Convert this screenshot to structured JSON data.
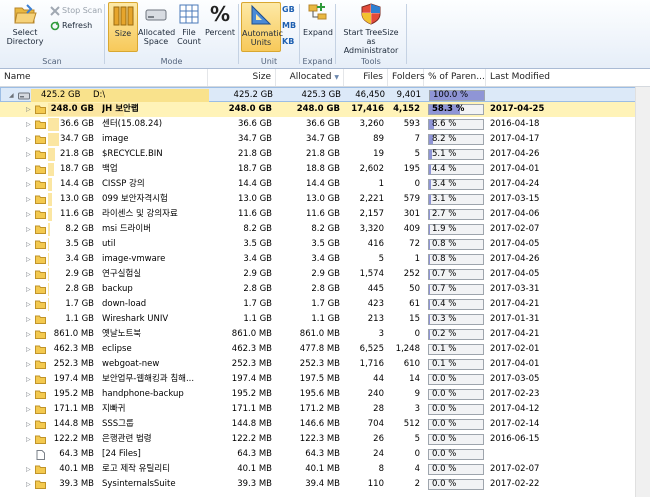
{
  "ribbon": {
    "select_directory": "Select\nDirectory",
    "stop_scan": "Stop Scan",
    "refresh": "Refresh",
    "scan_group": "Scan",
    "size": "Size",
    "allocated_space": "Allocated\nSpace",
    "file_count": "File\nCount",
    "percent": "Percent",
    "mode_group": "Mode",
    "automatic_units": "Automatic\nUnits",
    "unit_gb": "GB",
    "unit_mb": "MB",
    "unit_kb": "KB",
    "unit_group": "Unit",
    "expand": "Expand",
    "expand_group": "Expand",
    "start_admin": "Start TreeSize as\nAdministrator",
    "tools_group": "Tools",
    "percent_glyph": "%"
  },
  "columns": {
    "name": "Name",
    "size": "Size",
    "allocated": "Allocated",
    "files": "Files",
    "folders": "Folders",
    "pct": "% of Paren...",
    "last_modified": "Last Modified"
  },
  "root": {
    "bar_size": "425.2 GB",
    "name": "D:\\",
    "size": "425.2 GB",
    "allocated": "425.3 GB",
    "files": "46,450",
    "folders": "9,401",
    "pct_text": "100.0 %",
    "pct": 100,
    "modified": ""
  },
  "rows": [
    {
      "bar_size": "248.0 GB",
      "name": "JH 보안랩",
      "size": "248.0 GB",
      "allocated": "248.0 GB",
      "files": "17,416",
      "folders": "4,152",
      "pct_text": "58.3 %",
      "pct": 58.3,
      "modified": "2017-04-25",
      "selected": true,
      "kind": "folder"
    },
    {
      "bar_size": "36.6 GB",
      "name": "센터(15.08.24)",
      "size": "36.6 GB",
      "allocated": "36.6 GB",
      "files": "3,260",
      "folders": "593",
      "pct_text": "8.6 %",
      "pct": 8.6,
      "modified": "2016-04-18",
      "kind": "folder"
    },
    {
      "bar_size": "34.7 GB",
      "name": "image",
      "size": "34.7 GB",
      "allocated": "34.7 GB",
      "files": "89",
      "folders": "7",
      "pct_text": "8.2 %",
      "pct": 8.2,
      "modified": "2017-04-17",
      "kind": "folder"
    },
    {
      "bar_size": "21.8 GB",
      "name": "$RECYCLE.BIN",
      "size": "21.8 GB",
      "allocated": "21.8 GB",
      "files": "19",
      "folders": "5",
      "pct_text": "5.1 %",
      "pct": 5.1,
      "modified": "2017-04-26",
      "kind": "folder"
    },
    {
      "bar_size": "18.7 GB",
      "name": "백업",
      "size": "18.7 GB",
      "allocated": "18.8 GB",
      "files": "2,602",
      "folders": "195",
      "pct_text": "4.4 %",
      "pct": 4.4,
      "modified": "2017-04-01",
      "kind": "folder"
    },
    {
      "bar_size": "14.4 GB",
      "name": "CISSP 강의",
      "size": "14.4 GB",
      "allocated": "14.4 GB",
      "files": "1",
      "folders": "0",
      "pct_text": "3.4 %",
      "pct": 3.4,
      "modified": "2017-04-24",
      "kind": "folder"
    },
    {
      "bar_size": "13.0 GB",
      "name": "099 보안자격시험",
      "size": "13.0 GB",
      "allocated": "13.0 GB",
      "files": "2,221",
      "folders": "579",
      "pct_text": "3.1 %",
      "pct": 3.1,
      "modified": "2017-03-15",
      "kind": "folder"
    },
    {
      "bar_size": "11.6 GB",
      "name": "라이센스 및 강의자료",
      "size": "11.6 GB",
      "allocated": "11.6 GB",
      "files": "2,157",
      "folders": "301",
      "pct_text": "2.7 %",
      "pct": 2.7,
      "modified": "2017-04-06",
      "kind": "folder"
    },
    {
      "bar_size": "8.2 GB",
      "name": "msi 드라이버",
      "size": "8.2 GB",
      "allocated": "8.2 GB",
      "files": "3,320",
      "folders": "409",
      "pct_text": "1.9 %",
      "pct": 1.9,
      "modified": "2017-02-07",
      "kind": "folder"
    },
    {
      "bar_size": "3.5 GB",
      "name": "util",
      "size": "3.5 GB",
      "allocated": "3.5 GB",
      "files": "416",
      "folders": "72",
      "pct_text": "0.8 %",
      "pct": 0.8,
      "modified": "2017-04-05",
      "kind": "folder"
    },
    {
      "bar_size": "3.4 GB",
      "name": "image-vmware",
      "size": "3.4 GB",
      "allocated": "3.4 GB",
      "files": "5",
      "folders": "1",
      "pct_text": "0.8 %",
      "pct": 0.8,
      "modified": "2017-04-26",
      "kind": "folder"
    },
    {
      "bar_size": "2.9 GB",
      "name": "연구실험실",
      "size": "2.9 GB",
      "allocated": "2.9 GB",
      "files": "1,574",
      "folders": "252",
      "pct_text": "0.7 %",
      "pct": 0.7,
      "modified": "2017-04-05",
      "kind": "folder"
    },
    {
      "bar_size": "2.8 GB",
      "name": "backup",
      "size": "2.8 GB",
      "allocated": "2.8 GB",
      "files": "445",
      "folders": "50",
      "pct_text": "0.7 %",
      "pct": 0.7,
      "modified": "2017-03-31",
      "kind": "folder"
    },
    {
      "bar_size": "1.7 GB",
      "name": "down-load",
      "size": "1.7 GB",
      "allocated": "1.7 GB",
      "files": "423",
      "folders": "61",
      "pct_text": "0.4 %",
      "pct": 0.4,
      "modified": "2017-04-21",
      "kind": "folder"
    },
    {
      "bar_size": "1.1 GB",
      "name": "Wireshark UNIV",
      "size": "1.1 GB",
      "allocated": "1.1 GB",
      "files": "213",
      "folders": "15",
      "pct_text": "0.3 %",
      "pct": 0.3,
      "modified": "2017-01-31",
      "kind": "folder"
    },
    {
      "bar_size": "861.0 MB",
      "name": "옛날노트북",
      "size": "861.0 MB",
      "allocated": "861.0 MB",
      "files": "3",
      "folders": "0",
      "pct_text": "0.2 %",
      "pct": 0.2,
      "modified": "2017-04-21",
      "kind": "folder"
    },
    {
      "bar_size": "462.3 MB",
      "name": "eclipse",
      "size": "462.3 MB",
      "allocated": "477.8 MB",
      "files": "6,525",
      "folders": "1,248",
      "pct_text": "0.1 %",
      "pct": 0.1,
      "modified": "2017-02-01",
      "kind": "folder"
    },
    {
      "bar_size": "252.3 MB",
      "name": "webgoat-new",
      "size": "252.3 MB",
      "allocated": "252.3 MB",
      "files": "1,716",
      "folders": "610",
      "pct_text": "0.1 %",
      "pct": 0.1,
      "modified": "2017-04-01",
      "kind": "folder"
    },
    {
      "bar_size": "197.4 MB",
      "name": "보안업무-웹해킹과 침해...",
      "size": "197.4 MB",
      "allocated": "197.5 MB",
      "files": "44",
      "folders": "14",
      "pct_text": "0.0 %",
      "pct": 0,
      "modified": "2017-03-05",
      "kind": "folder"
    },
    {
      "bar_size": "195.2 MB",
      "name": "handphone-backup",
      "size": "195.2 MB",
      "allocated": "195.6 MB",
      "files": "240",
      "folders": "9",
      "pct_text": "0.0 %",
      "pct": 0,
      "modified": "2017-02-23",
      "kind": "folder"
    },
    {
      "bar_size": "171.1 MB",
      "name": "지빠귀",
      "size": "171.1 MB",
      "allocated": "171.2 MB",
      "files": "28",
      "folders": "3",
      "pct_text": "0.0 %",
      "pct": 0,
      "modified": "2017-04-12",
      "kind": "folder"
    },
    {
      "bar_size": "144.8 MB",
      "name": "SSS그룹",
      "size": "144.8 MB",
      "allocated": "146.6 MB",
      "files": "704",
      "folders": "512",
      "pct_text": "0.0 %",
      "pct": 0,
      "modified": "2017-02-14",
      "kind": "folder"
    },
    {
      "bar_size": "122.2 MB",
      "name": "은행관련 법령",
      "size": "122.2 MB",
      "allocated": "122.3 MB",
      "files": "26",
      "folders": "5",
      "pct_text": "0.0 %",
      "pct": 0,
      "modified": "2016-06-15",
      "kind": "folder"
    },
    {
      "bar_size": "64.3 MB",
      "name": "[24 Files]",
      "size": "64.3 MB",
      "allocated": "64.3 MB",
      "files": "24",
      "folders": "0",
      "pct_text": "0.0 %",
      "pct": 0,
      "modified": "",
      "kind": "files"
    },
    {
      "bar_size": "40.1 MB",
      "name": "로고 제작 유틸리티",
      "size": "40.1 MB",
      "allocated": "40.1 MB",
      "files": "8",
      "folders": "4",
      "pct_text": "0.0 %",
      "pct": 0,
      "modified": "2017-02-07",
      "kind": "folder"
    },
    {
      "bar_size": "39.3 MB",
      "name": "SysinternalsSuite",
      "size": "39.3 MB",
      "allocated": "39.4 MB",
      "files": "110",
      "folders": "2",
      "pct_text": "0.0 %",
      "pct": 0,
      "modified": "2017-02-22",
      "kind": "folder"
    }
  ]
}
